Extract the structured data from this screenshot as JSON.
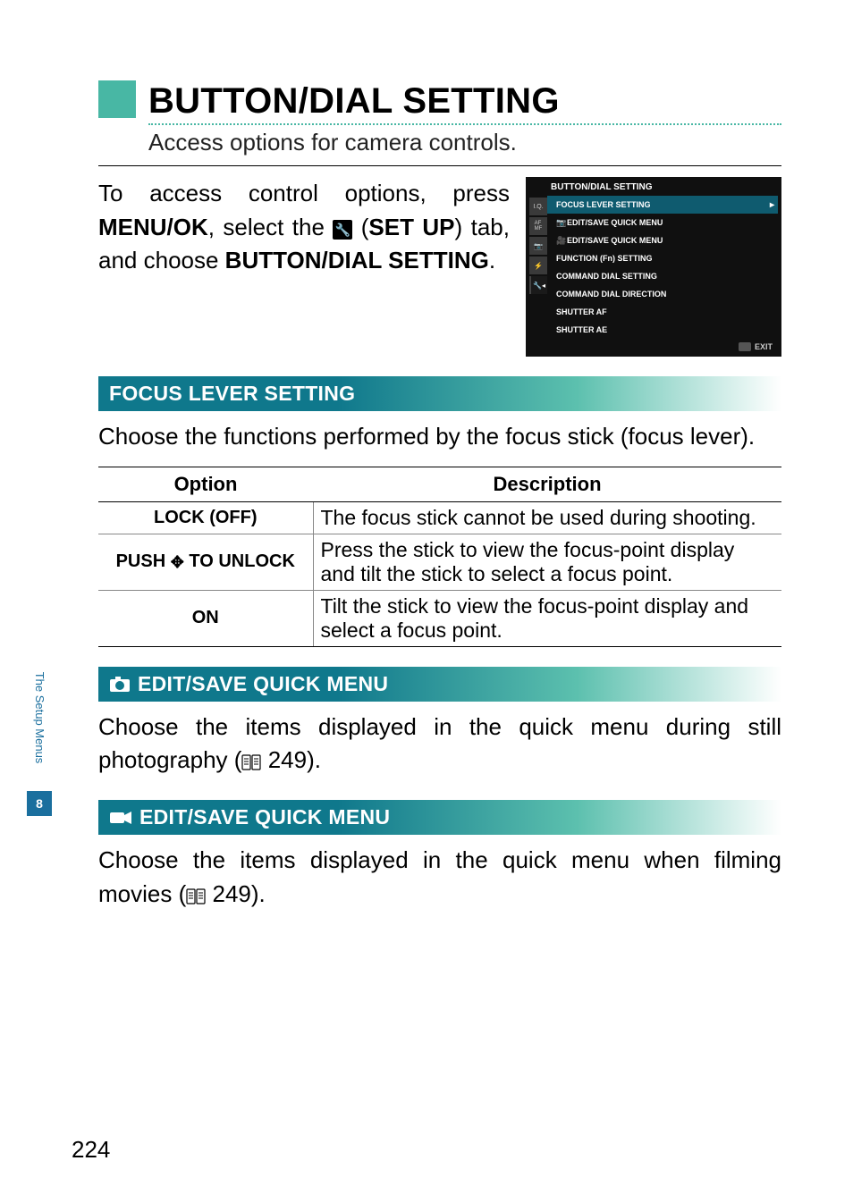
{
  "side": {
    "tab_label": "The Setup Menus",
    "chapter_number": "8"
  },
  "heading": {
    "title": "BUTTON/DIAL SETTING",
    "subtitle": "Access options for camera controls."
  },
  "intro": {
    "part1": "To access control options, press ",
    "menu_ok": "MENU/OK",
    "part2": ", select the ",
    "setup": "SET UP",
    "part3": " tab, and choose ",
    "bds": "BUTTON/DIAL SETTING",
    "part4": "."
  },
  "menu": {
    "title": "BUTTON/DIAL SETTING",
    "tabs": [
      "I.Q.",
      "AF\nMF",
      "📷",
      "⚡",
      "🔧"
    ],
    "items": [
      {
        "label": "FOCUS LEVER SETTING",
        "highlight": true,
        "arrow": true
      },
      {
        "label": "EDIT/SAVE QUICK MENU",
        "pre": "camera"
      },
      {
        "label": "EDIT/SAVE QUICK MENU",
        "pre": "movie"
      },
      {
        "label": "FUNCTION (Fn) SETTING"
      },
      {
        "label": "COMMAND DIAL SETTING"
      },
      {
        "label": "COMMAND DIAL DIRECTION"
      },
      {
        "label": "SHUTTER AF"
      },
      {
        "label": "SHUTTER AE"
      }
    ],
    "footer": "EXIT"
  },
  "sections": {
    "focus_lever": {
      "title": "FOCUS LEVER SETTING",
      "desc": "Choose the functions performed by the focus stick (focus lever).",
      "table": {
        "head_option": "Option",
        "head_desc": "Description",
        "rows": [
          {
            "opt": "LOCK (OFF)",
            "desc": "The focus stick cannot be used during shooting."
          },
          {
            "opt": "PUSH ⊛ TO UNLOCK",
            "desc": "Press the stick to view the focus-point display and tilt the stick to select a focus point."
          },
          {
            "opt": "ON",
            "desc": "Tilt the stick to view the focus-point display and select a focus point."
          }
        ]
      }
    },
    "edit_still": {
      "title": "EDIT/SAVE QUICK MENU",
      "body_1": "Choose the items displayed in the quick menu during still photography (",
      "page": "249",
      "body_2": ")."
    },
    "edit_movie": {
      "title": "EDIT/SAVE QUICK MENU",
      "body_1": "Choose the items displayed in the quick menu when filming movies (",
      "page": "249",
      "body_2": ")."
    }
  },
  "page_number": "224"
}
